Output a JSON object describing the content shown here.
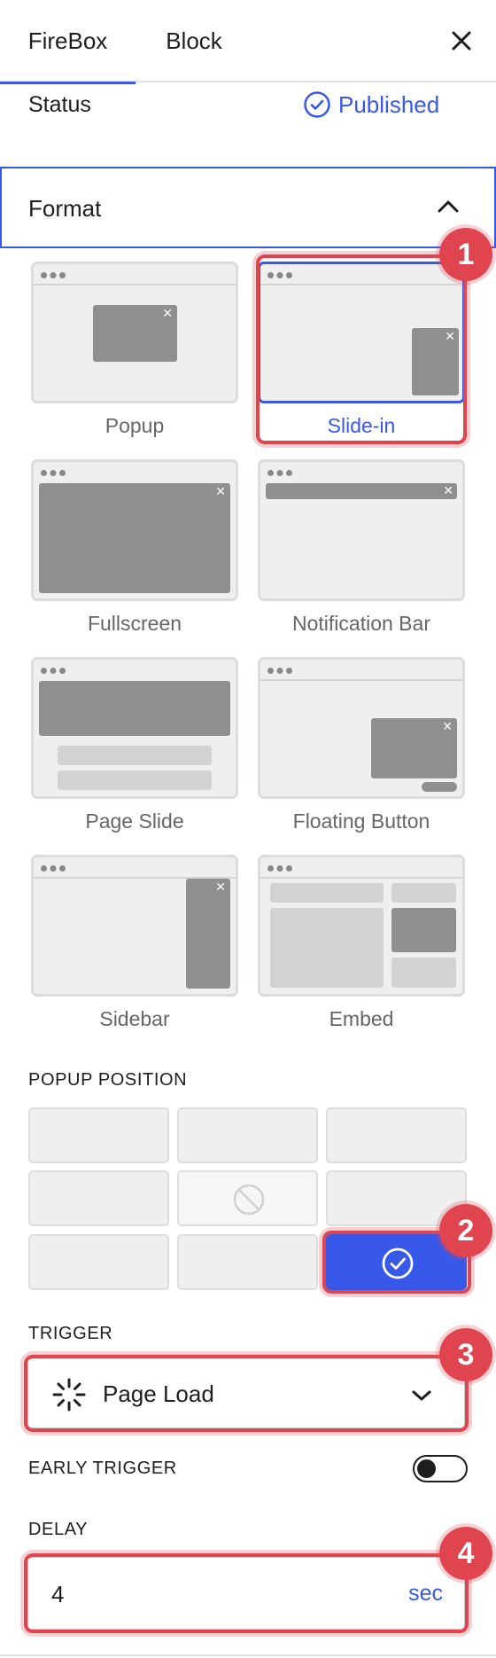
{
  "tabs": [
    {
      "label": "FireBox",
      "active": true
    },
    {
      "label": "Block",
      "active": false
    }
  ],
  "status": {
    "label": "Status",
    "value": "Published"
  },
  "format": {
    "title": "Format",
    "options": [
      {
        "label": "Popup",
        "selected": false
      },
      {
        "label": "Slide-in",
        "selected": true
      },
      {
        "label": "Fullscreen",
        "selected": false
      },
      {
        "label": "Notification Bar",
        "selected": false
      },
      {
        "label": "Page Slide",
        "selected": false
      },
      {
        "label": "Floating Button",
        "selected": false
      },
      {
        "label": "Sidebar",
        "selected": false
      },
      {
        "label": "Embed",
        "selected": false
      }
    ]
  },
  "popup_position": {
    "title": "POPUP POSITION",
    "selected": "bottom-right",
    "disabled": "center"
  },
  "trigger": {
    "title": "TRIGGER",
    "value": "Page Load"
  },
  "early_trigger": {
    "title": "EARLY TRIGGER",
    "enabled": false
  },
  "delay": {
    "title": "DELAY",
    "value": "4",
    "unit": "sec"
  },
  "annotations": [
    "1",
    "2",
    "3",
    "4"
  ],
  "colors": {
    "accent": "#3858e9",
    "annotation": "#e0454f",
    "thumb_bg": "#efefef",
    "thumb_shape": "#8f8f8f"
  }
}
